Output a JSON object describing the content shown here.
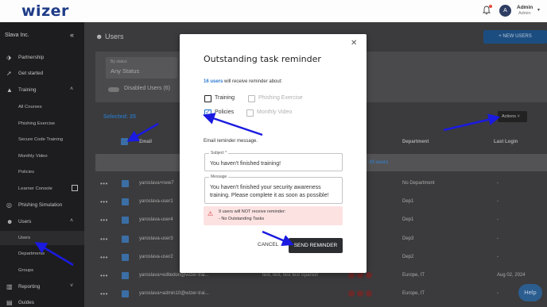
{
  "topbar": {
    "logo": "wizer",
    "avatar_initial": "A",
    "user_name": "Admin",
    "user_role": "Admin"
  },
  "sidebar": {
    "org": "Slava Inc.",
    "items": [
      {
        "label": "Partnership",
        "icon": "tag-icon"
      },
      {
        "label": "Get started",
        "icon": "rocket-icon"
      },
      {
        "label": "Training",
        "icon": "graduation-cap-icon"
      },
      {
        "label": "All Courses"
      },
      {
        "label": "Phishing Exercise"
      },
      {
        "label": "Secure Code Training"
      },
      {
        "label": "Monthly Video"
      },
      {
        "label": "Policies"
      },
      {
        "label": "Learner Console"
      },
      {
        "label": "Phishing Simulation",
        "icon": "target-icon"
      },
      {
        "label": "Users",
        "icon": "users-icon"
      },
      {
        "label": "Users"
      },
      {
        "label": "Departments"
      },
      {
        "label": "Groups"
      },
      {
        "label": "Reporting",
        "icon": "chart-icon"
      },
      {
        "label": "Guides",
        "icon": "book-icon"
      }
    ]
  },
  "main": {
    "title": "Users",
    "new_users_button": "NEW USERS",
    "by_status_label": "By status",
    "by_status_value": "Any Status",
    "disabled_users_label": "Disabled Users (6)",
    "selected_label": "Selected: 25",
    "actions_label": "Actions",
    "columns": {
      "email": "Email",
      "department": "Department",
      "last_login": "Last Login"
    },
    "banner_text": "43 users",
    "rows": [
      {
        "email": "yaroslava+new7",
        "department": "No Department",
        "last_login": "-",
        "extra": ""
      },
      {
        "email": "yaroslava-user1",
        "department": "Dep1",
        "last_login": "-",
        "extra": ""
      },
      {
        "email": "yaroslava-user4",
        "department": "Dep1",
        "last_login": "-",
        "extra": ""
      },
      {
        "email": "yaroslava-user3",
        "department": "Dep3",
        "last_login": "-",
        "extra": ""
      },
      {
        "email": "yaroslava-user2",
        "department": "Dep2",
        "last_login": "-",
        "extra": ""
      },
      {
        "email": "yaroslava+editedon@wizer-trai...",
        "department": "Europe, IT",
        "last_login": "Aug 02, 2024",
        "extra": "test, test, test test   Spanish"
      },
      {
        "email": "yaroslava+admin10@wizer-trai...",
        "department": "Europe, IT",
        "last_login": "-",
        "extra": ""
      }
    ],
    "help_label": "Help"
  },
  "modal": {
    "title": "Outstanding task reminder",
    "users_link": "16 users",
    "users_text": " will receive reminder about:",
    "options": [
      {
        "label": "Training",
        "checked": false,
        "disabled": false
      },
      {
        "label": "Phishing Exercise",
        "checked": false,
        "disabled": true
      },
      {
        "label": "Policies",
        "checked": true,
        "disabled": false
      },
      {
        "label": "Monthly Video",
        "checked": false,
        "disabled": true
      }
    ],
    "email_section_label": "Email reminder message.",
    "subject_label": "Subject *",
    "subject_value": "You haven't finished training!",
    "message_label": "Message",
    "message_value": "You haven't finished your security awareness training. Please complete it as soon as possible!",
    "warning_line1": "9 users will NOT receive reminder:",
    "warning_line2": "- No Outstanding Tasks",
    "cancel_label": "CANCEL",
    "send_label": "SEND REMINDER"
  },
  "colors": {
    "accent": "#2a7ad2",
    "brand": "#1f3c88",
    "annotation_arrow": "#1a1ae0",
    "warning_bg": "#fde2e2"
  }
}
